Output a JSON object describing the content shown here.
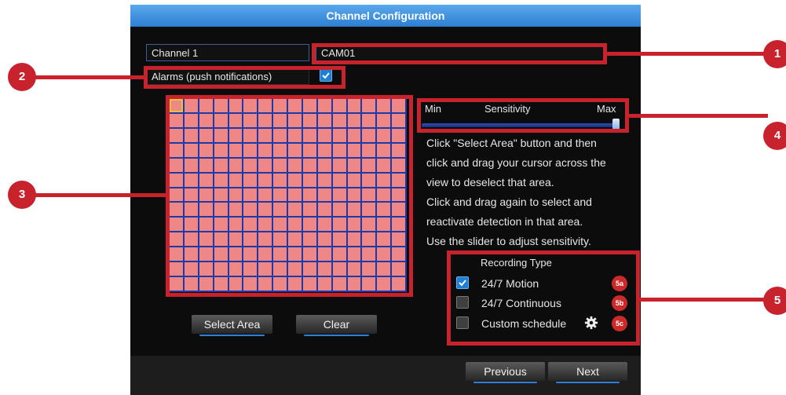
{
  "dialog": {
    "title": "Channel Configuration",
    "channel_label": "Channel 1",
    "camera_name": "CAM01",
    "alarms_label": "Alarms (push notifications)",
    "alarms_checked": true
  },
  "sensitivity": {
    "min_label": "Min",
    "title": "Sensitivity",
    "max_label": "Max",
    "value_fraction": 1.0
  },
  "instructions": [
    "Click \"Select Area\" button and then",
    "click and drag your cursor across the",
    "view to deselect that area.",
    "Click and drag again to select and",
    "reactivate detection in that area.",
    "Use the slider to adjust sensitivity."
  ],
  "recording": {
    "title": "Recording Type",
    "options": [
      {
        "label": "24/7 Motion",
        "checked": true,
        "badge": "5a"
      },
      {
        "label": "24/7 Continuous",
        "checked": false,
        "badge": "5b"
      },
      {
        "label": "Custom schedule",
        "checked": false,
        "badge": "5c"
      }
    ]
  },
  "buttons": {
    "select_area": "Select Area",
    "clear": "Clear",
    "previous": "Previous",
    "next": "Next"
  },
  "callouts": [
    "1",
    "2",
    "3",
    "4",
    "5"
  ],
  "colors": {
    "accent": "#2d7fd3",
    "callout_red": "#c8232c",
    "grid_cell": "#f08787",
    "grid_line": "#1c3aa8"
  }
}
